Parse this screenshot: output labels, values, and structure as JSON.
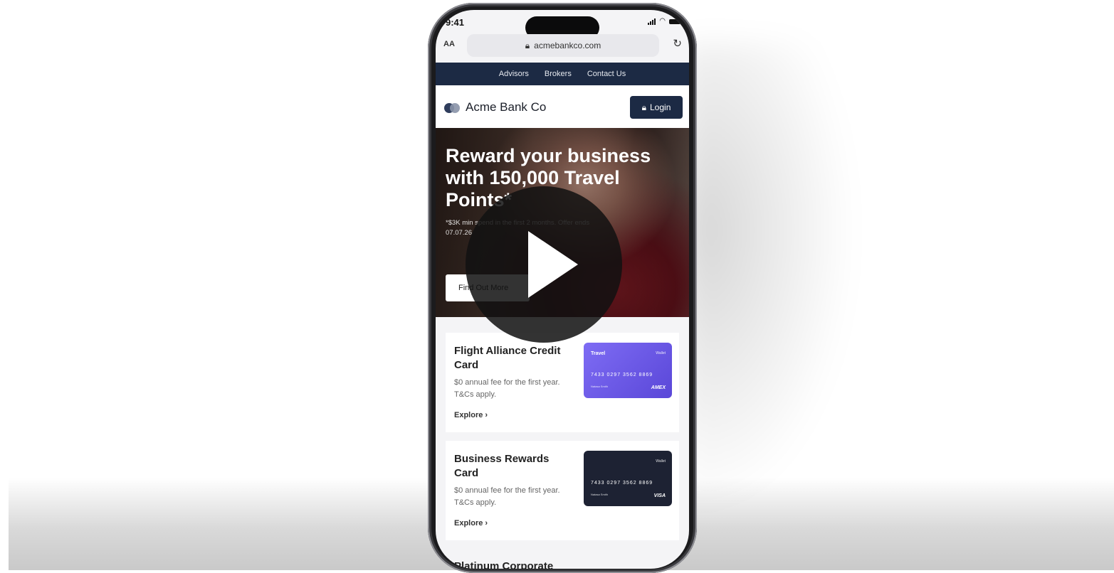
{
  "status_bar": {
    "time": "9:41"
  },
  "browser": {
    "text_size_label": "AA",
    "url": "acmebankco.com"
  },
  "top_nav": {
    "items": [
      "Advisors",
      "Brokers",
      "Contact Us"
    ]
  },
  "header": {
    "brand": "Acme Bank Co",
    "login_label": "Login"
  },
  "hero": {
    "title": "Reward your business with 150,000 Travel Points*",
    "fine_print": "*$3K min spend in the first 2 months. Offer ends 07.07.26",
    "cta_label": "Find Out More"
  },
  "products": [
    {
      "title": "Flight Alliance Credit Card",
      "description": "$0 annual fee for the first year. T&Cs apply.",
      "link": "Explore",
      "card": {
        "name": "Travel",
        "wallet": "Wallet",
        "number": "7433 0297 3562 8869",
        "holder": "Natasa Smith",
        "network": "AMEX"
      }
    },
    {
      "title": "Business Rewards Card",
      "description": "$0 annual fee for the first year. T&Cs apply.",
      "link": "Explore",
      "card": {
        "name": "",
        "wallet": "Wallet",
        "number": "7433 0297 3562 8869",
        "holder": "Natasa Smith",
        "network": "VISA"
      }
    }
  ],
  "next_product_peek": "Platinum Corporate",
  "video": {
    "play_icon": "play-icon"
  },
  "colors": {
    "navy": "#1c2a44",
    "travel_card": "#6a58e6",
    "biz_card": "#1d2233"
  }
}
